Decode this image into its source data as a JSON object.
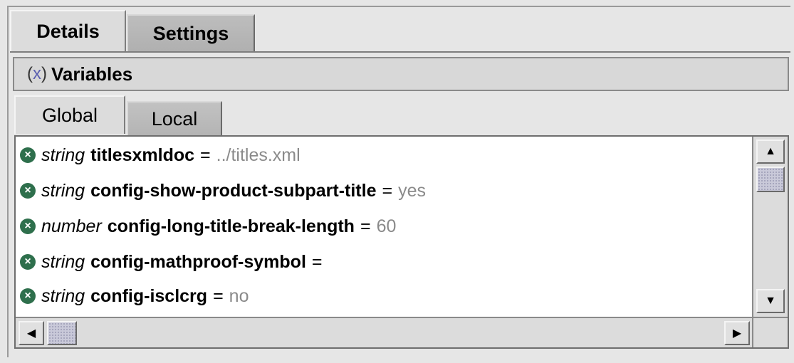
{
  "tabs": {
    "details": "Details",
    "settings": "Settings"
  },
  "panel": {
    "icon_text": "(x)",
    "title": "Variables"
  },
  "inner_tabs": {
    "global": "Global",
    "local": "Local"
  },
  "variables": [
    {
      "type": "string",
      "name": "titlesxmldoc",
      "eq": "=",
      "value": "../titles.xml"
    },
    {
      "type": "string",
      "name": "config-show-product-subpart-title",
      "eq": "=",
      "value": "yes"
    },
    {
      "type": "number",
      "name": "config-long-title-break-length",
      "eq": "=",
      "value": "60"
    },
    {
      "type": "string",
      "name": "config-mathproof-symbol",
      "eq": "=",
      "value": ""
    },
    {
      "type": "string",
      "name": "config-isclcrg",
      "eq": "=",
      "value": "no"
    }
  ],
  "icons": {
    "row": "remove-icon",
    "up": "arrow-up-icon",
    "down": "arrow-down-icon",
    "left": "arrow-left-icon",
    "right": "arrow-right-icon"
  },
  "colors": {
    "row_icon": "#2e6f4c",
    "value_text": "#8a8a8a",
    "icon_x": "#5b5fb0"
  }
}
